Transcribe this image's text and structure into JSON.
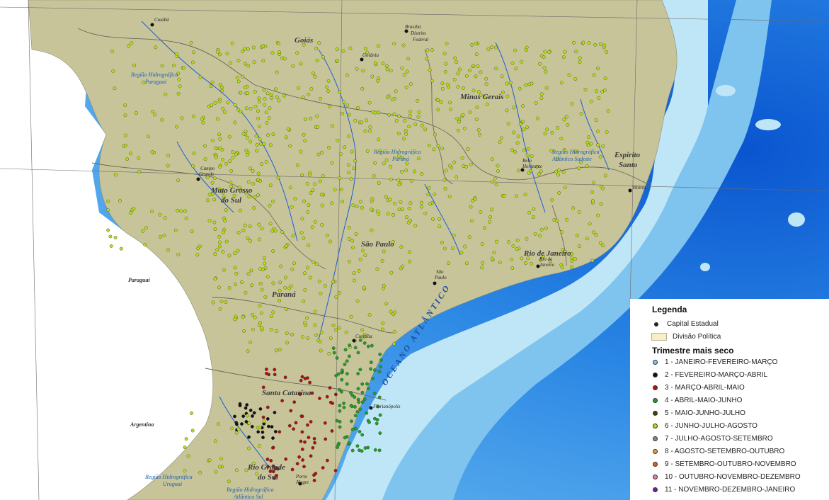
{
  "map": {
    "states": [
      "Goiás",
      "Minas Gerais",
      "Espírito Santo",
      "Mato Grosso do Sul",
      "São Paulo",
      "Rio de Janeiro",
      "Paraná",
      "Santa Catarina",
      "Rio Grande do Sul"
    ],
    "state_lines": {
      "espirito_santo": [
        "Espírito",
        "Santo"
      ],
      "mato_grosso": [
        "Mato Grosso",
        "do Sul"
      ],
      "rio_grande": [
        "Rio Grande",
        "do Sul"
      ]
    },
    "capitals": {
      "cuiaba": "Cuiabá",
      "brasilia": "Brasília",
      "distrito": [
        "Distrito",
        "Federal"
      ],
      "goiania": "Goiânia",
      "bh": [
        "Belo",
        "Horizonte"
      ],
      "vitoria": "Vitória",
      "campo_grande": [
        "Campo",
        "Grande"
      ],
      "sao_paulo": [
        "São",
        "Paulo"
      ],
      "rio": [
        "Rio de",
        "Janeiro"
      ],
      "curitiba": "Curitiba",
      "florianopolis": "Florianópolis",
      "porto_alegre": [
        "Porto",
        "Alegre"
      ]
    },
    "hydro_regions": {
      "paraguai": [
        "Região Hidrográfica",
        "Paraguai"
      ],
      "parana": [
        "Região Hidrográfica",
        "Paraná"
      ],
      "atlantico_sudeste": [
        "Região Hidrográfica",
        "Atlântico Sudeste"
      ],
      "uruguai": [
        "Região Hidrográfica",
        "Uruguai"
      ],
      "atlantico_sul": [
        "Região Hidrográfica",
        "Atlântico Sul"
      ]
    },
    "countries": {
      "paraguai": "Paraguai",
      "argentina": "Argentina"
    },
    "ocean": "OCEANO ATLÂNTICO",
    "colors": {
      "land": "#c8c49a",
      "ocean_deep": "#1e6fd9",
      "ocean_shelf": "#bfe3f5",
      "river": "#1a5fd0"
    }
  },
  "legend": {
    "title": "Legenda",
    "capital_label": "Capital Estadual",
    "division_label": "Divisão Política",
    "trimester_title": "Trimestre mais seco",
    "items": [
      {
        "label": "1 - JANEIRO-FEVEREIRO-MARÇO",
        "color": "#7ec8f0"
      },
      {
        "label": "2 - FEVEREIRO-MARÇO-ABRIL",
        "color": "#111111"
      },
      {
        "label": "3 - MARÇO-ABRIL-MAIO",
        "color": "#b01010"
      },
      {
        "label": "4 - ABRIL-MAIO-JUNHO",
        "color": "#22a022"
      },
      {
        "label": "5 - MAIO-JUNHO-JULHO",
        "color": "#4a3a10"
      },
      {
        "label": "6 - JUNHO-JULHO-AGOSTO",
        "color": "#b8e010"
      },
      {
        "label": "7 - JULHO-AGOSTO-SETEMBRO",
        "color": "#888888"
      },
      {
        "label": "8 - AGOSTO-SETEMBRO-OUTUBRO",
        "color": "#e0a040"
      },
      {
        "label": "9 - SETEMBRO-OUTUBRO-NOVEMBRO",
        "color": "#e06010"
      },
      {
        "label": "10 - OUTUBRO-NOVEMBRO-DEZEMBRO",
        "color": "#e080b0"
      },
      {
        "label": "11 - NOVEMBRO-DEZEMBRO-JANEIRO",
        "color": "#7020a0"
      }
    ]
  }
}
